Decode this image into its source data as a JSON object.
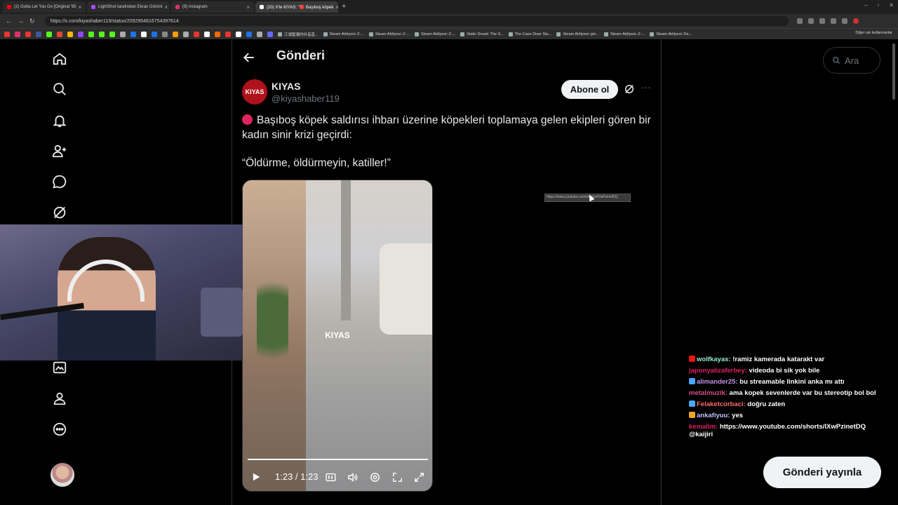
{
  "browser": {
    "tabs": [
      {
        "title": "(2) Gotta Let You Go [Original '95",
        "color": "#ff0000"
      },
      {
        "title": "LightShot tarafından Ekran Görünt",
        "color": "#a64dff"
      },
      {
        "title": "(9) Instagram",
        "color": "#e1306c"
      },
      {
        "title": "(20) X'te KIYAS: \"🔴 Başıboş köpek",
        "color": "#ffffff"
      }
    ],
    "url": "https://x.com/kiyashaber119/status/2092954816754397614",
    "bookmarks": [
      "江湖雲瀾的抖音直...",
      "Steam Atölyesi::Z-...",
      "Steam Atölyesi::Z-...",
      "Steam Atölyesi::Z-...",
      "Static Dread: The S...",
      "The Cave Diver Ste...",
      "Steam Atölyesi::gm...",
      "Steam Atölyesi::Z-...",
      "Steam Atölyesi::De..."
    ],
    "other_bookmarks": "Diğer yer işaretleri",
    "other_bookmarks_shown": "Diğer sık kullanılanlar"
  },
  "nav": {
    "icons": [
      "home-icon",
      "search-icon",
      "notifications-icon",
      "follow-icon",
      "messages-icon",
      "grok-icon",
      "communities-icon",
      "premium-icon",
      "bookmarks-icon",
      "profile-icon",
      "more-icon"
    ]
  },
  "post": {
    "page_title": "Gönderi",
    "author_avatar_text": "KIYAS",
    "author_name": "KIYAS",
    "author_handle": "@kiyashaber119",
    "subscribe_label": "Abone ol",
    "text": "Başıboş köpek saldırısı ihbarı üzerine köpekleri toplamaya gelen ekipleri gören bir kadın sinir krizi geçirdi:",
    "quote": "“Öldürme, öldürmeyin, katiller!”",
    "video": {
      "watermark": "KIYAS",
      "time": "1:23 / 1:23",
      "progress": 1.0
    }
  },
  "tooltip": "https://www.youtube.com/shorts/IXwPzinetDQ",
  "search": {
    "placeholder": "Ara"
  },
  "chat": [
    {
      "user": "wolfkayas:",
      "msg": "!ramiz kamerada katarakt var",
      "color": "#9be8c8",
      "badge": "#e91916"
    },
    {
      "user": "japonyalizaferbey:",
      "msg": "videoda bi sik yok bile",
      "color": "#e0245e",
      "badge": ""
    },
    {
      "user": "alimander25:",
      "msg": "bu streamable linkini anka mı attı",
      "color": "#c792ea",
      "badge": "#4aa8ff"
    },
    {
      "user": "metalmuzik:",
      "msg": "ama kopek sevenlerde var bu stereotip bol bol",
      "color": "#d84f8c",
      "badge": ""
    },
    {
      "user": "Felaketcorbaci:",
      "msg": "doğru zaten",
      "color": "#ff6b6b",
      "badge": "#4aa8ff"
    },
    {
      "user": "ankafiyuu:",
      "msg": "yes",
      "color": "#c0c0ff",
      "badge": "#f5a623"
    },
    {
      "user": "kemalim:",
      "msg": "https://www.youtube.com/shorts/IXwPzinetDQ @kaijiri",
      "color": "#e0245e",
      "badge": ""
    }
  ],
  "publish_label": "Gönderi yayınla"
}
